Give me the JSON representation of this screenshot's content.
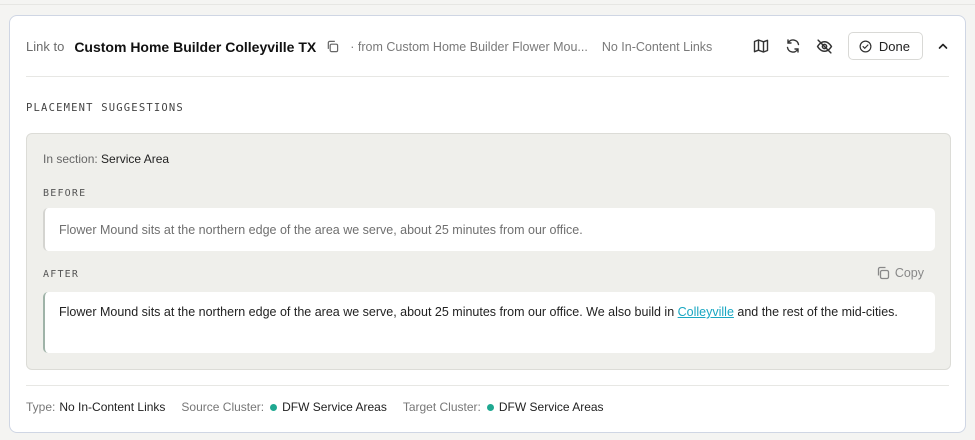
{
  "header": {
    "link_to_label": "Link to",
    "target_title": "Custom Home Builder Colleyville TX",
    "from_prefix": "· from",
    "from_source": "Custom Home Builder Flower Mou...",
    "link_type": "No In-Content Links",
    "done_label": "Done"
  },
  "placement": {
    "section_label": "PLACEMENT SUGGESTIONS",
    "in_section_prefix": "In section:",
    "in_section_name": "Service Area",
    "before_label": "BEFORE",
    "before_text": "Flower Mound sits at the northern edge of the area we serve, about 25 minutes from our office.",
    "after_label": "AFTER",
    "copy_label": "Copy",
    "after_text_pre": "Flower Mound sits at the northern edge of the area we serve, about 25 minutes from our office. We also build in ",
    "after_link_text": "Colleyville",
    "after_text_post": " and the rest of the mid-cities."
  },
  "footer": {
    "type_label": "Type:",
    "type_value": "No In-Content Links",
    "source_label": "Source Cluster:",
    "source_value": "DFW Service Areas",
    "target_label": "Target Cluster:",
    "target_value": "DFW Service Areas"
  },
  "colors": {
    "link": "#19a7c2",
    "cluster_dot": "#1fa891",
    "card_border": "#cfd6e4"
  },
  "icons": [
    "copy-icon",
    "map-icon",
    "refresh-icon",
    "eye-off-icon",
    "check-circle-icon",
    "chevron-up-icon"
  ]
}
